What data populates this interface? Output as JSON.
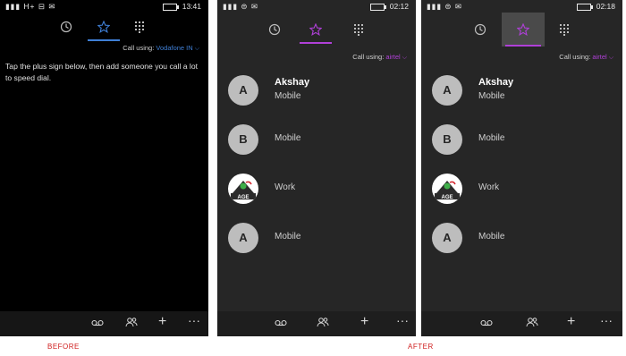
{
  "before": {
    "status_left": "H+",
    "time": "13:41",
    "call_using_label": "Call using:",
    "call_using_network": "Vodafone IN",
    "hint_text": "Tap the plus sign below, then add someone you call a lot to speed dial.",
    "caption": "BEFORE"
  },
  "after": {
    "caption": "AFTER",
    "screen1": {
      "time": "02:12",
      "call_using_label": "Call using:",
      "call_using_network": "airtel"
    },
    "screen2": {
      "time": "02:18",
      "call_using_label": "Call using:",
      "call_using_network": "airtel"
    },
    "contacts": [
      {
        "initial": "A",
        "name": "Akshay",
        "type": "Mobile",
        "avatar": "letter"
      },
      {
        "initial": "B",
        "name": "",
        "type": "Mobile",
        "avatar": "letter"
      },
      {
        "initial": "",
        "name": "",
        "type": "Work",
        "avatar": "logo",
        "logo_text": "AGE"
      },
      {
        "initial": "A",
        "name": "",
        "type": "Mobile",
        "avatar": "letter"
      }
    ]
  },
  "icons": {
    "history": "history-icon",
    "speed_dial": "star-icon",
    "keypad": "keypad-icon",
    "voicemail": "voicemail-icon",
    "contacts": "people-icon",
    "add": "plus-icon",
    "more": "more-icon"
  },
  "colors": {
    "accent_before": "#3f7fd6",
    "accent_after": "#b040d8",
    "caption": "#d02020"
  }
}
